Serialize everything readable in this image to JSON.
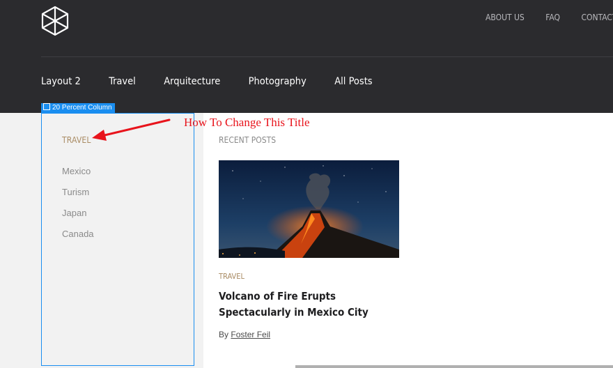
{
  "header": {
    "top_nav": [
      "ABOUT US",
      "FAQ",
      "CONTACT US"
    ],
    "main_nav": [
      "Layout 2",
      "Travel",
      "Arquitecture",
      "Photography",
      "All Posts"
    ]
  },
  "editor": {
    "column_badge": "20 Percent Column",
    "annotation": "How To Change This Title",
    "outline_color": "#1a8ef0",
    "annotation_color": "#e8141c"
  },
  "sidebar": {
    "title": "TRAVEL",
    "categories": [
      "Mexico",
      "Turism",
      "Japan",
      "Canada"
    ]
  },
  "main": {
    "recent_title": "RECENT POSTS",
    "post": {
      "image": "volcano-eruption-night-photo",
      "category": "TRAVEL",
      "title": "Volcano of Fire Erupts Spectacularly in Mexico City",
      "by": "By",
      "author": "Foster Feil"
    }
  },
  "colors": {
    "header_bg": "#2b2b2e",
    "accent": "#a98b63",
    "sidebar_bg": "#f2f2f2"
  }
}
